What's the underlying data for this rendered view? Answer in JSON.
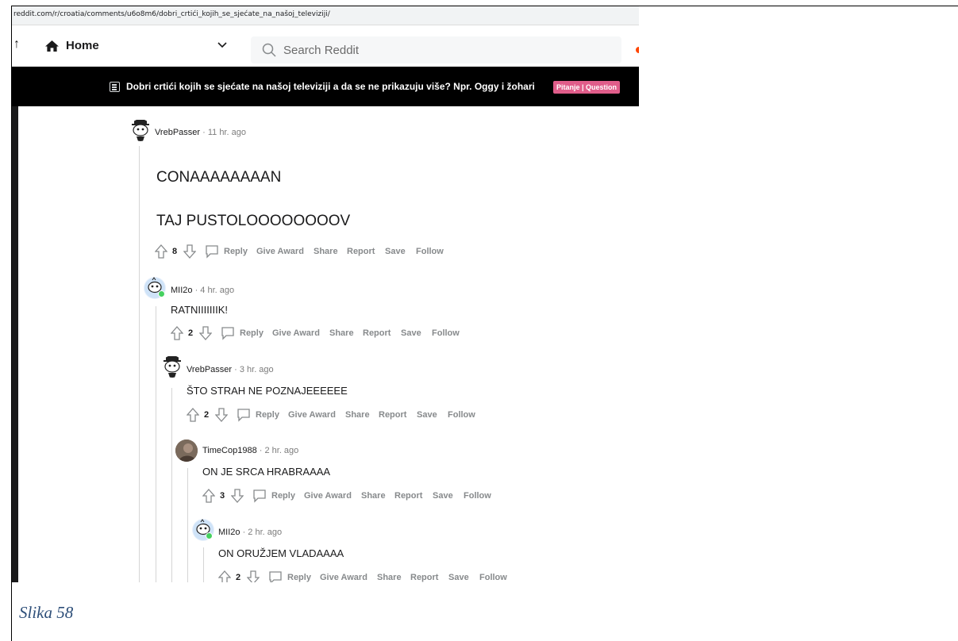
{
  "browser": {
    "url": "reddit.com/r/croatia/comments/u6o8m6/dobri_crtići_kojih_se_sjećate_na_našoj_televiziji/"
  },
  "nav": {
    "home_label": "Home",
    "search_placeholder": "Search Reddit",
    "icons": [
      "home-icon",
      "chevron-down-icon",
      "search-icon"
    ]
  },
  "post_bar": {
    "title": "Dobri crtići kojih se sjećate na našoj televiziji a da se ne prikazuju više? Npr. Oggy i žohari",
    "flair": "Pitanje | Question",
    "flair_color": "#e05d8a"
  },
  "actions": {
    "reply": "Reply",
    "give_award": "Give Award",
    "share": "Share",
    "report": "Report",
    "save": "Save",
    "follow": "Follow"
  },
  "comments": [
    {
      "user": "VrebPasser",
      "time": "· 11 hr. ago",
      "lines": [
        "CONAAAAAAAAN",
        "TAJ PUSTOLOOOOOOOOV"
      ],
      "score": "8"
    },
    {
      "user": "MII2o",
      "time": "· 4 hr. ago",
      "lines": [
        "RATNIIIIIIIK!"
      ],
      "score": "2"
    },
    {
      "user": "VrebPasser",
      "time": "· 3 hr. ago",
      "lines": [
        "ŠTO STRAH NE POZNAJEEEEEE"
      ],
      "score": "2"
    },
    {
      "user": "TimeCop1988",
      "time": "· 2 hr. ago",
      "lines": [
        "ON JE SRCA HRABRAAAA"
      ],
      "score": "3"
    },
    {
      "user": "MII2o",
      "time": "· 2 hr. ago",
      "lines": [
        "ON ORUŽJEM VLADAAAA"
      ],
      "score": "2"
    }
  ],
  "caption": "Slika 58"
}
